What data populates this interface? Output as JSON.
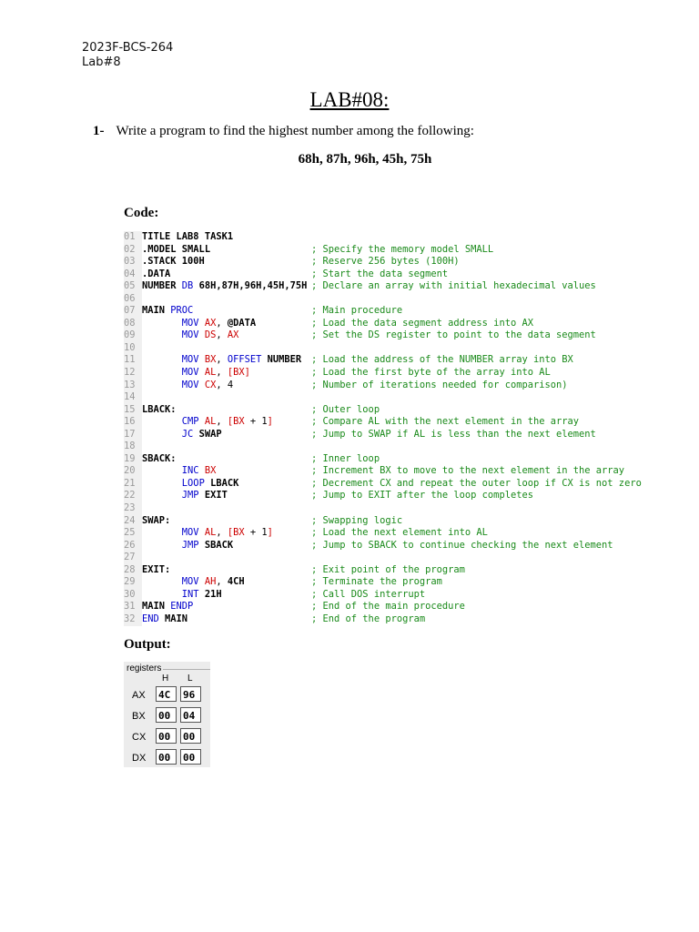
{
  "header": {
    "id": "2023F-BCS-264",
    "lab": "Lab#8"
  },
  "title": "LAB#08:",
  "question": {
    "number": "1-",
    "text": "Write a program to find the highest number among the following:"
  },
  "values_line": "68h, 87h, 96h, 45h, 75h",
  "code_label": "Code:",
  "output_label": "Output:",
  "code_lines": [
    {
      "n": "01",
      "parts": [
        [
          "lbl",
          "TITLE LAB8 TASK1"
        ]
      ],
      "c": ""
    },
    {
      "n": "02",
      "parts": [
        [
          "lbl",
          ".MODEL SMALL"
        ]
      ],
      "c": "; Specify the memory model SMALL"
    },
    {
      "n": "03",
      "parts": [
        [
          "lbl",
          ".STACK 100H"
        ]
      ],
      "c": "; Reserve 256 bytes (100H)"
    },
    {
      "n": "04",
      "parts": [
        [
          "lbl",
          ".DATA"
        ]
      ],
      "c": "; Start the data segment"
    },
    {
      "n": "05",
      "parts": [
        [
          "lbl",
          "NUMBER "
        ],
        [
          "kw",
          "DB "
        ],
        [
          "lbl",
          "68H,87H,96H,45H,75H"
        ]
      ],
      "c": "; Declare an array with initial hexadecimal values"
    },
    {
      "n": "06",
      "parts": [],
      "c": ""
    },
    {
      "n": "07",
      "parts": [
        [
          "lbl",
          "MAIN "
        ],
        [
          "kw",
          "PROC"
        ]
      ],
      "c": "; Main procedure"
    },
    {
      "n": "08",
      "parts": [
        [
          "sp",
          "       "
        ],
        [
          "kw",
          "MOV "
        ],
        [
          "reg",
          "AX"
        ],
        [
          "num",
          ", "
        ],
        [
          "lbl",
          "@DATA"
        ]
      ],
      "c": "; Load the data segment address into AX"
    },
    {
      "n": "09",
      "parts": [
        [
          "sp",
          "       "
        ],
        [
          "kw",
          "MOV "
        ],
        [
          "reg",
          "DS"
        ],
        [
          "num",
          ", "
        ],
        [
          "reg",
          "AX"
        ]
      ],
      "c": "; Set the DS register to point to the data segment"
    },
    {
      "n": "10",
      "parts": [],
      "c": ""
    },
    {
      "n": "11",
      "parts": [
        [
          "sp",
          "       "
        ],
        [
          "kw",
          "MOV "
        ],
        [
          "reg",
          "BX"
        ],
        [
          "num",
          ", "
        ],
        [
          "kw",
          "OFFSET "
        ],
        [
          "lbl",
          "NUMBER"
        ]
      ],
      "c": "; Load the address of the NUMBER array into BX"
    },
    {
      "n": "12",
      "parts": [
        [
          "sp",
          "       "
        ],
        [
          "kw",
          "MOV "
        ],
        [
          "reg",
          "AL"
        ],
        [
          "num",
          ", "
        ],
        [
          "reg",
          "[BX]"
        ]
      ],
      "c": "; Load the first byte of the array into AL"
    },
    {
      "n": "13",
      "parts": [
        [
          "sp",
          "       "
        ],
        [
          "kw",
          "MOV "
        ],
        [
          "reg",
          "CX"
        ],
        [
          "num",
          ", 4"
        ]
      ],
      "c": "; Number of iterations needed for comparison)"
    },
    {
      "n": "14",
      "parts": [],
      "c": ""
    },
    {
      "n": "15",
      "parts": [
        [
          "lbl",
          "LBACK:"
        ]
      ],
      "c": "; Outer loop"
    },
    {
      "n": "16",
      "parts": [
        [
          "sp",
          "       "
        ],
        [
          "kw",
          "CMP "
        ],
        [
          "reg",
          "AL"
        ],
        [
          "num",
          ", "
        ],
        [
          "reg",
          "[BX"
        ],
        [
          "num",
          " + 1"
        ],
        [
          "reg",
          "]"
        ]
      ],
      "c": "; Compare AL with the next element in the array"
    },
    {
      "n": "17",
      "parts": [
        [
          "sp",
          "       "
        ],
        [
          "kw",
          "JC "
        ],
        [
          "lbl",
          "SWAP"
        ]
      ],
      "c": "; Jump to SWAP if AL is less than the next element"
    },
    {
      "n": "18",
      "parts": [],
      "c": ""
    },
    {
      "n": "19",
      "parts": [
        [
          "lbl",
          "SBACK:"
        ]
      ],
      "c": "; Inner loop"
    },
    {
      "n": "20",
      "parts": [
        [
          "sp",
          "       "
        ],
        [
          "kw",
          "INC "
        ],
        [
          "reg",
          "BX"
        ]
      ],
      "c": "; Increment BX to move to the next element in the array"
    },
    {
      "n": "21",
      "parts": [
        [
          "sp",
          "       "
        ],
        [
          "kw",
          "LOOP "
        ],
        [
          "lbl",
          "LBACK"
        ]
      ],
      "c": "; Decrement CX and repeat the outer loop if CX is not zero"
    },
    {
      "n": "22",
      "parts": [
        [
          "sp",
          "       "
        ],
        [
          "kw",
          "JMP "
        ],
        [
          "lbl",
          "EXIT"
        ]
      ],
      "c": "; Jump to EXIT after the loop completes"
    },
    {
      "n": "23",
      "parts": [],
      "c": ""
    },
    {
      "n": "24",
      "parts": [
        [
          "lbl",
          "SWAP:"
        ]
      ],
      "c": "; Swapping logic"
    },
    {
      "n": "25",
      "parts": [
        [
          "sp",
          "       "
        ],
        [
          "kw",
          "MOV "
        ],
        [
          "reg",
          "AL"
        ],
        [
          "num",
          ", "
        ],
        [
          "reg",
          "[BX"
        ],
        [
          "num",
          " + 1"
        ],
        [
          "reg",
          "]"
        ]
      ],
      "c": "; Load the next element into AL"
    },
    {
      "n": "26",
      "parts": [
        [
          "sp",
          "       "
        ],
        [
          "kw",
          "JMP "
        ],
        [
          "lbl",
          "SBACK"
        ]
      ],
      "c": "; Jump to SBACK to continue checking the next element"
    },
    {
      "n": "27",
      "parts": [],
      "c": ""
    },
    {
      "n": "28",
      "parts": [
        [
          "lbl",
          "EXIT:"
        ]
      ],
      "c": "; Exit point of the program"
    },
    {
      "n": "29",
      "parts": [
        [
          "sp",
          "       "
        ],
        [
          "kw",
          "MOV "
        ],
        [
          "reg",
          "AH"
        ],
        [
          "num",
          ", "
        ],
        [
          "lbl",
          "4CH"
        ]
      ],
      "c": "; Terminate the program"
    },
    {
      "n": "30",
      "parts": [
        [
          "sp",
          "       "
        ],
        [
          "kw",
          "INT "
        ],
        [
          "lbl",
          "21H"
        ]
      ],
      "c": "; Call DOS interrupt"
    },
    {
      "n": "31",
      "parts": [
        [
          "lbl",
          "MAIN "
        ],
        [
          "kw",
          "ENDP"
        ]
      ],
      "c": "; End of the main procedure"
    },
    {
      "n": "32",
      "parts": [
        [
          "kw",
          "END "
        ],
        [
          "lbl",
          "MAIN"
        ]
      ],
      "c": "; End of the program"
    }
  ],
  "registers": {
    "title": "registers",
    "col_h": "H",
    "col_l": "L",
    "rows": [
      {
        "name": "AX",
        "h": "4C",
        "l": "96"
      },
      {
        "name": "BX",
        "h": "00",
        "l": "04"
      },
      {
        "name": "CX",
        "h": "00",
        "l": "00"
      },
      {
        "name": "DX",
        "h": "00",
        "l": "00"
      }
    ]
  }
}
